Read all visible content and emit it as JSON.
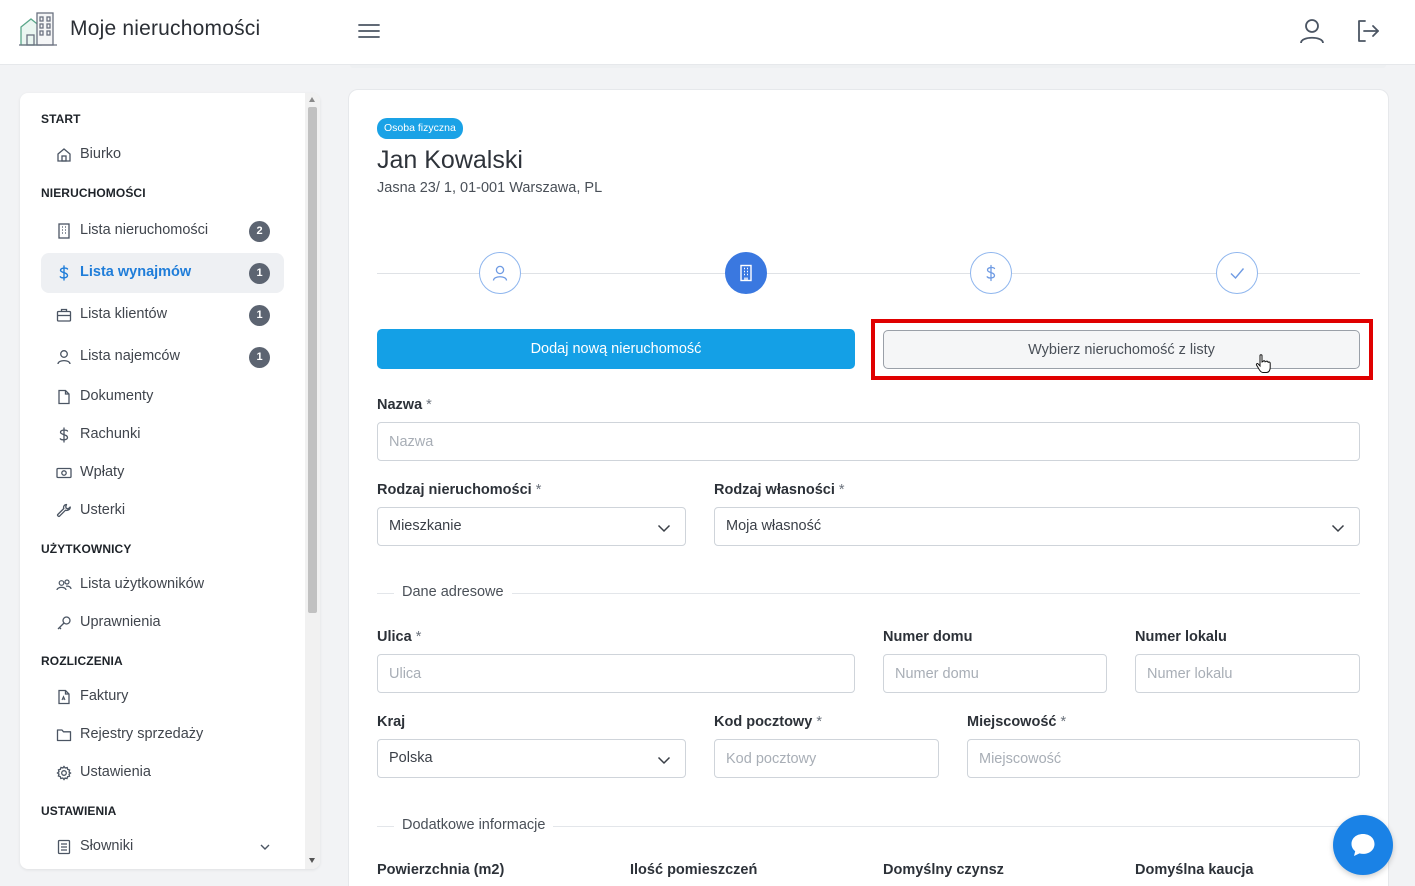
{
  "header": {
    "app_title": "Moje nieruchomości"
  },
  "sidebar": {
    "sections": {
      "start": "START",
      "properties": "NIERUCHOMOŚCI",
      "users": "UŻYTKOWNICY",
      "billing": "ROZLICZENIA",
      "settings": "USTAWIENIA"
    },
    "items": [
      {
        "label": "Biurko",
        "icon": "home-icon"
      },
      {
        "label": "Lista nieruchomości",
        "icon": "building-icon",
        "badge": "2"
      },
      {
        "label": "Lista wynajmów",
        "icon": "dollar-icon",
        "badge": "1",
        "active": true
      },
      {
        "label": "Lista klientów",
        "icon": "briefcase-icon",
        "badge": "1"
      },
      {
        "label": "Lista najemców",
        "icon": "user-icon",
        "badge": "1"
      },
      {
        "label": "Dokumenty",
        "icon": "file-icon"
      },
      {
        "label": "Rachunki",
        "icon": "dollar-icon"
      },
      {
        "label": "Wpłaty",
        "icon": "cash-icon"
      },
      {
        "label": "Usterki",
        "icon": "wrench-icon"
      },
      {
        "label": "Lista użytkowników",
        "icon": "users-icon"
      },
      {
        "label": "Uprawnienia",
        "icon": "key-icon"
      },
      {
        "label": "Faktury",
        "icon": "invoice-icon"
      },
      {
        "label": "Rejestry sprzedaży",
        "icon": "folder-icon"
      },
      {
        "label": "Ustawienia",
        "icon": "gear-icon"
      },
      {
        "label": "Słowniki",
        "icon": "book-icon"
      }
    ]
  },
  "client": {
    "type_badge": "Osoba fizyczna",
    "name": "Jan Kowalski",
    "address": "Jasna 23/ 1, 01-001 Warszawa, PL"
  },
  "steps": [
    "user-icon",
    "building-icon",
    "dollar-icon",
    "check-icon"
  ],
  "buttons": {
    "add_new": "Dodaj nową nieruchomość",
    "choose_from_list": "Wybierz nieruchomość z listy"
  },
  "form": {
    "name_label": "Nazwa",
    "name_placeholder": "Nazwa",
    "property_type_label": "Rodzaj nieruchomości",
    "property_type_value": "Mieszkanie",
    "ownership_label": "Rodzaj własności",
    "ownership_value": "Moja własność",
    "address_section": "Dane adresowe",
    "street_label": "Ulica",
    "street_placeholder": "Ulica",
    "house_no_label": "Numer domu",
    "house_no_placeholder": "Numer domu",
    "apt_no_label": "Numer lokalu",
    "apt_no_placeholder": "Numer lokalu",
    "country_label": "Kraj",
    "country_value": "Polska",
    "postal_label": "Kod pocztowy",
    "postal_placeholder": "Kod pocztowy",
    "city_label": "Miejscowość",
    "city_placeholder": "Miejscowość",
    "extra_section": "Dodatkowe informacje",
    "area_label": "Powierzchnia (m2)",
    "rooms_label": "Ilość pomieszczeń",
    "rent_label": "Domyślny czynsz",
    "deposit_label": "Domyślna kaucja",
    "required_mark": "*"
  },
  "colors": {
    "accent": "#14a0e6",
    "active_nav": "#1f7dd9",
    "highlight": "#e00000",
    "chat": "#1a82e6"
  }
}
